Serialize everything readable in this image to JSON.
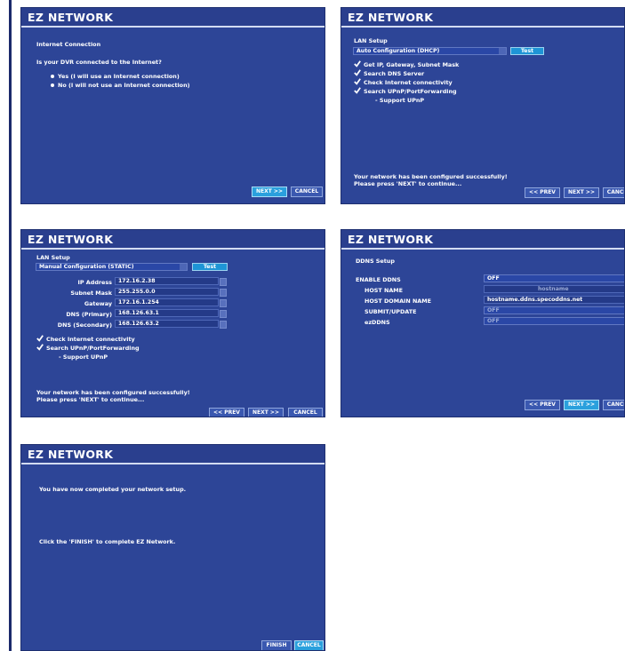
{
  "app_title": "EZ NETWORK",
  "colors": {
    "panel": "#2d4597",
    "title_bar": "#2a3f8e",
    "primary_button": "#2aa0dd",
    "test_button": "#1e95d6"
  },
  "icons": {
    "check": "check-icon",
    "bullet": "radio-bullet-icon"
  },
  "panel1": {
    "title": "EZ NETWORK",
    "heading": "Internet Connection",
    "question": "Is your DVR connected to the Internet?",
    "options": [
      {
        "label": "Yes (I will use an Internet connection)",
        "selected": false
      },
      {
        "label": "No (I will not use an Internet connection)",
        "selected": true
      }
    ],
    "next": "NEXT >>",
    "cancel": "CANCEL"
  },
  "panel2": {
    "title": "EZ NETWORK",
    "heading": "LAN Setup",
    "mode": "Auto Configuration (DHCP)",
    "test": "Test",
    "checks": [
      "Get IP, Gateway, Subnet Mask",
      "Search DNS Server",
      "Check Internet connectivity",
      "Search UPnP/PortForwarding"
    ],
    "sub": "- Support UPnP",
    "msg1": "Your network has been configured successfully!",
    "msg2": "Please press 'NEXT' to continue...",
    "prev": "<< PREV",
    "next": "NEXT >>",
    "cancel": "CANCEL"
  },
  "panel3": {
    "title": "EZ NETWORK",
    "heading": "LAN Setup",
    "mode": "Manual Configuration (STATIC)",
    "test": "Test",
    "fields": [
      {
        "label": "IP Address",
        "value": "172.16.2.38"
      },
      {
        "label": "Subnet Mask",
        "value": "255.255.0.0"
      },
      {
        "label": "Gateway",
        "value": "172.16.1.254"
      },
      {
        "label": "DNS (Primary)",
        "value": "168.126.63.1"
      },
      {
        "label": "DNS (Secondary)",
        "value": "168.126.63.2"
      }
    ],
    "checks": [
      "Check Internet connectivity",
      "Search UPnP/PortForwarding"
    ],
    "sub": "- Support UPnP",
    "msg1": "Your network has been configured successfully!",
    "msg2": "Please press 'NEXT' to continue...",
    "prev": "<< PREV",
    "next": "NEXT >>",
    "cancel": "CANCEL"
  },
  "panel4": {
    "title": "EZ NETWORK",
    "heading": "DDNS Setup",
    "enable_label": "ENABLE DDNS",
    "enable_value": "OFF",
    "host_name_label": "HOST NAME",
    "host_name_value": "hostname",
    "host_domain_label": "HOST DOMAIN NAME",
    "host_domain_value": "hostname.ddns.specoddns.net",
    "submit_label": "SUBMIT/UPDATE",
    "submit_value": "OFF",
    "ezddns_label": "ezDDNS",
    "ezddns_value": "OFF",
    "prev": "<< PREV",
    "next": "NEXT >>",
    "cancel": "CANCEL"
  },
  "panel5": {
    "title": "EZ NETWORK",
    "msg1": "You have now completed your network setup.",
    "msg2": "Click the 'FINISH' to complete EZ Network.",
    "finish": "FINISH",
    "cancel": "CANCEL"
  }
}
